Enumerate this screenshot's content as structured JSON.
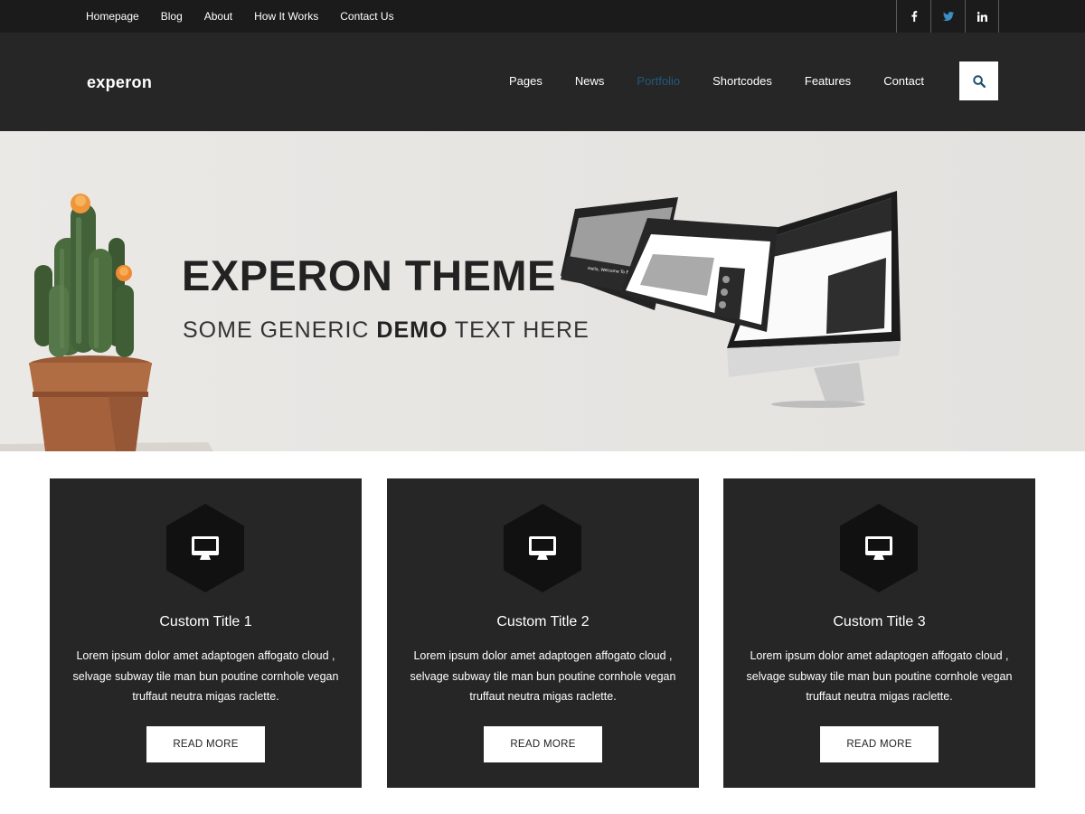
{
  "topbar": {
    "links": [
      "Homepage",
      "Blog",
      "About",
      "How It Works",
      "Contact Us"
    ],
    "socials": [
      "facebook-icon",
      "twitter-icon",
      "linkedin-icon"
    ],
    "twitter_color": "#3a8fc4"
  },
  "header": {
    "logo": "experon",
    "nav": [
      "Pages",
      "News",
      "Portfolio",
      "Shortcodes",
      "Features",
      "Contact"
    ],
    "active_nav": "Portfolio",
    "active_color": "#22597a",
    "search_icon": "search-icon"
  },
  "hero": {
    "title": "EXPERON THEME",
    "subtitle_start": "SOME GENERIC ",
    "subtitle_bold": "DEMO",
    "subtitle_end": " TEXT HERE",
    "mock_screen_text": "Hello, Welcome To Experon"
  },
  "cards": [
    {
      "icon": "monitor-icon",
      "title": "Custom Title 1",
      "text": "Lorem ipsum dolor amet adaptogen affogato cloud , selvage subway tile man bun poutine cornhole vegan truffaut neutra migas raclette.",
      "button": "READ MORE"
    },
    {
      "icon": "monitor-icon",
      "title": "Custom Title 2",
      "text": "Lorem ipsum dolor amet adaptogen affogato cloud , selvage subway tile man bun poutine cornhole vegan truffaut neutra migas raclette.",
      "button": "READ MORE"
    },
    {
      "icon": "monitor-icon",
      "title": "Custom Title 3",
      "text": "Lorem ipsum dolor amet adaptogen affogato cloud , selvage subway tile man bun poutine cornhole vegan truffaut neutra migas raclette.",
      "button": "READ MORE"
    }
  ]
}
